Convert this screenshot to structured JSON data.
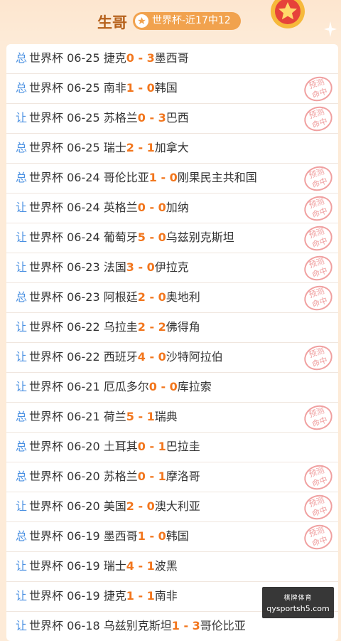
{
  "header": {
    "title": "生哥",
    "badge_label": "世界杯-近17中12",
    "medal_icon": "star-medal-icon",
    "accent_color": "#f2761d",
    "badge_color": "#f1a24e"
  },
  "stamp_text": [
    "预测",
    "命中"
  ],
  "matches": [
    {
      "tag": "总",
      "league": "世界杯",
      "date": "06-25",
      "home": "捷克",
      "home_score": "0",
      "away_score": "3",
      "away": "墨西哥",
      "hit": false
    },
    {
      "tag": "总",
      "league": "世界杯",
      "date": "06-25",
      "home": "南非",
      "home_score": "1",
      "away_score": "0",
      "away": "韩国",
      "hit": true
    },
    {
      "tag": "让",
      "league": "世界杯",
      "date": "06-25",
      "home": "苏格兰",
      "home_score": "0",
      "away_score": "3",
      "away": "巴西",
      "hit": true
    },
    {
      "tag": "总",
      "league": "世界杯",
      "date": "06-25",
      "home": "瑞士",
      "home_score": "2",
      "away_score": "1",
      "away": "加拿大",
      "hit": false
    },
    {
      "tag": "总",
      "league": "世界杯",
      "date": "06-24",
      "home": "哥伦比亚",
      "home_score": "1",
      "away_score": "0",
      "away": "刚果民主共和国",
      "hit": true
    },
    {
      "tag": "让",
      "league": "世界杯",
      "date": "06-24",
      "home": "英格兰",
      "home_score": "0",
      "away_score": "0",
      "away": "加纳",
      "hit": true
    },
    {
      "tag": "让",
      "league": "世界杯",
      "date": "06-24",
      "home": "葡萄牙",
      "home_score": "5",
      "away_score": "0",
      "away": "乌兹别克斯坦",
      "hit": true
    },
    {
      "tag": "让",
      "league": "世界杯",
      "date": "06-23",
      "home": "法国",
      "home_score": "3",
      "away_score": "0",
      "away": "伊拉克",
      "hit": true
    },
    {
      "tag": "总",
      "league": "世界杯",
      "date": "06-23",
      "home": "阿根廷",
      "home_score": "2",
      "away_score": "0",
      "away": "奥地利",
      "hit": true
    },
    {
      "tag": "让",
      "league": "世界杯",
      "date": "06-22",
      "home": "乌拉圭",
      "home_score": "2",
      "away_score": "2",
      "away": "佛得角",
      "hit": false
    },
    {
      "tag": "让",
      "league": "世界杯",
      "date": "06-22",
      "home": "西班牙",
      "home_score": "4",
      "away_score": "0",
      "away": "沙特阿拉伯",
      "hit": true
    },
    {
      "tag": "让",
      "league": "世界杯",
      "date": "06-21",
      "home": "厄瓜多尔",
      "home_score": "0",
      "away_score": "0",
      "away": "库拉索",
      "hit": false
    },
    {
      "tag": "总",
      "league": "世界杯",
      "date": "06-21",
      "home": "荷兰",
      "home_score": "5",
      "away_score": "1",
      "away": "瑞典",
      "hit": true
    },
    {
      "tag": "总",
      "league": "世界杯",
      "date": "06-20",
      "home": "土耳其",
      "home_score": "0",
      "away_score": "1",
      "away": "巴拉圭",
      "hit": false
    },
    {
      "tag": "总",
      "league": "世界杯",
      "date": "06-20",
      "home": "苏格兰",
      "home_score": "0",
      "away_score": "1",
      "away": "摩洛哥",
      "hit": true
    },
    {
      "tag": "让",
      "league": "世界杯",
      "date": "06-20",
      "home": "美国",
      "home_score": "2",
      "away_score": "0",
      "away": "澳大利亚",
      "hit": true
    },
    {
      "tag": "总",
      "league": "世界杯",
      "date": "06-19",
      "home": "墨西哥",
      "home_score": "1",
      "away_score": "0",
      "away": "韩国",
      "hit": true
    },
    {
      "tag": "让",
      "league": "世界杯",
      "date": "06-19",
      "home": "瑞士",
      "home_score": "4",
      "away_score": "1",
      "away": "波黑",
      "hit": false
    },
    {
      "tag": "让",
      "league": "世界杯",
      "date": "06-19",
      "home": "捷克",
      "home_score": "1",
      "away_score": "1",
      "away": "南非",
      "hit": false
    },
    {
      "tag": "让",
      "league": "世界杯",
      "date": "06-18",
      "home": "乌兹别克斯坦",
      "home_score": "1",
      "away_score": "3",
      "away": "哥伦比亚",
      "hit": false
    }
  ],
  "watermark": {
    "label": "棋牌体育",
    "domain": "qysportsh5.com"
  }
}
